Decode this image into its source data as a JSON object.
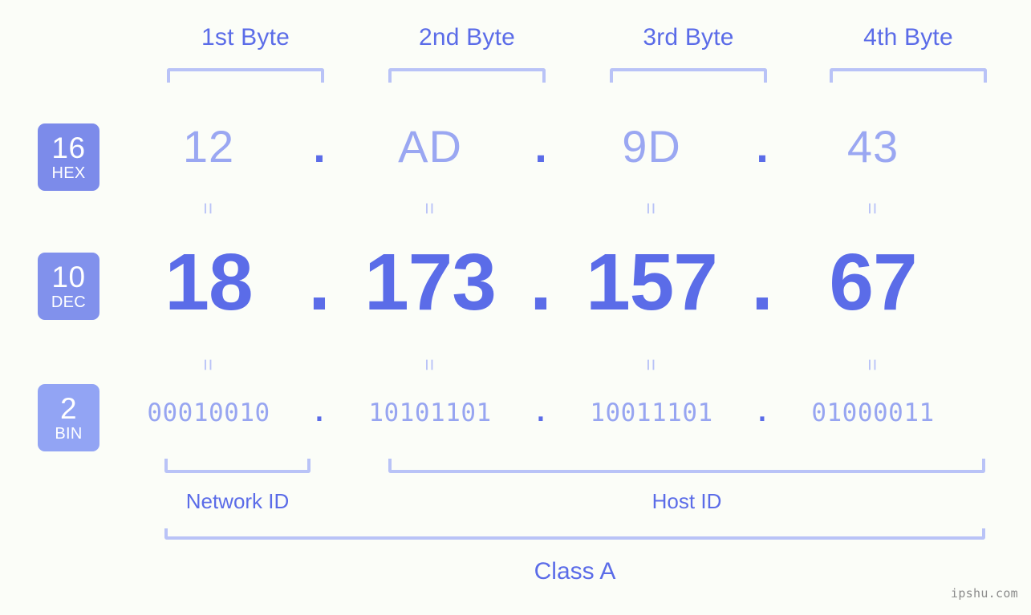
{
  "meta": {
    "background_color": "#fbfdf8",
    "accent_color": "#5b6ce8",
    "light_accent_color": "#9aa7f2",
    "bracket_color": "#b9c3f7"
  },
  "byte_headers": [
    {
      "label": "1st Byte"
    },
    {
      "label": "2nd Byte"
    },
    {
      "label": "3rd Byte"
    },
    {
      "label": "4th Byte"
    }
  ],
  "bases": [
    {
      "number": "16",
      "tag": "HEX",
      "color": "#7c8bea"
    },
    {
      "number": "10",
      "tag": "DEC",
      "color": "#8191ec"
    },
    {
      "number": "2",
      "tag": "BIN",
      "color": "#92a4f4"
    }
  ],
  "rows": {
    "hex": {
      "values": [
        "12",
        "AD",
        "9D",
        "43"
      ],
      "separator": "."
    },
    "dec": {
      "values": [
        "18",
        "173",
        "157",
        "67"
      ],
      "separator": "."
    },
    "bin": {
      "values": [
        "00010010",
        "10101101",
        "10011101",
        "01000011"
      ],
      "separator": "."
    }
  },
  "equals": {
    "symbol": "=",
    "count": 4
  },
  "segments": {
    "network_id": "Network ID",
    "host_id": "Host ID"
  },
  "class": {
    "label": "Class A"
  },
  "watermark": {
    "text": "ipshu.com"
  }
}
